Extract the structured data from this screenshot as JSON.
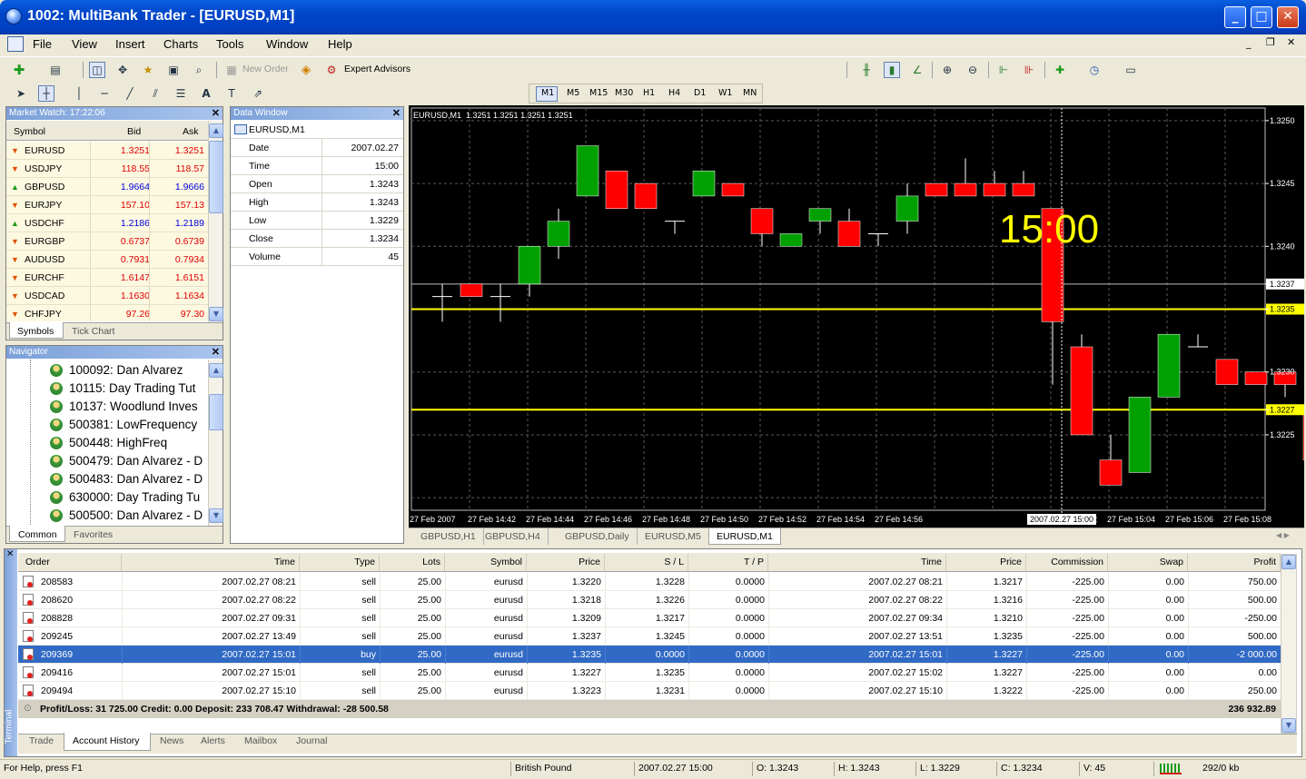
{
  "window": {
    "title": "1002: MultiBank Trader - [EURUSD,M1]"
  },
  "menu": [
    "File",
    "View",
    "Insert",
    "Charts",
    "Tools",
    "Window",
    "Help"
  ],
  "toolbar": {
    "new_order": "New Order",
    "expert_advisors": "Expert Advisors"
  },
  "timeframes": [
    "M1",
    "M5",
    "M15",
    "M30",
    "H1",
    "H4",
    "D1",
    "W1",
    "MN"
  ],
  "market_watch": {
    "title": "Market Watch: 17:22:06",
    "headers": {
      "symbol": "Symbol",
      "bid": "Bid",
      "ask": "Ask"
    },
    "rows": [
      {
        "symbol": "EURUSD",
        "bid": "1.3251",
        "ask": "1.3251",
        "dir": "down",
        "color": "#e00000"
      },
      {
        "symbol": "USDJPY",
        "bid": "118.55",
        "ask": "118.57",
        "dir": "down",
        "color": "#e00000"
      },
      {
        "symbol": "GBPUSD",
        "bid": "1.9664",
        "ask": "1.9666",
        "dir": "up",
        "color": "#0000e0"
      },
      {
        "symbol": "EURJPY",
        "bid": "157.10",
        "ask": "157.13",
        "dir": "down",
        "color": "#e00000"
      },
      {
        "symbol": "USDCHF",
        "bid": "1.2186",
        "ask": "1.2189",
        "dir": "up",
        "color": "#0000e0"
      },
      {
        "symbol": "EURGBP",
        "bid": "0.6737",
        "ask": "0.6739",
        "dir": "down",
        "color": "#e00000"
      },
      {
        "symbol": "AUDUSD",
        "bid": "0.7931",
        "ask": "0.7934",
        "dir": "down",
        "color": "#e00000"
      },
      {
        "symbol": "EURCHF",
        "bid": "1.6147",
        "ask": "1.6151",
        "dir": "down",
        "color": "#e00000"
      },
      {
        "symbol": "USDCAD",
        "bid": "1.1630",
        "ask": "1.1634",
        "dir": "down",
        "color": "#e00000"
      },
      {
        "symbol": "CHFJPY",
        "bid": "97.26",
        "ask": "97.30",
        "dir": "down",
        "color": "#e00000"
      }
    ],
    "tabs": [
      "Symbols",
      "Tick Chart"
    ]
  },
  "data_window": {
    "title": "Data Window",
    "symbol": "EURUSD,M1",
    "rows": [
      {
        "label": "Date",
        "value": "2007.02.27"
      },
      {
        "label": "Time",
        "value": "15:00"
      },
      {
        "label": "Open",
        "value": "1.3243"
      },
      {
        "label": "High",
        "value": "1.3243"
      },
      {
        "label": "Low",
        "value": "1.3229"
      },
      {
        "label": "Close",
        "value": "1.3234"
      },
      {
        "label": "Volume",
        "value": "45"
      }
    ]
  },
  "navigator": {
    "title": "Navigator",
    "items": [
      "100092: Dan Alvarez",
      "10115: Day Trading Tut",
      "10137: Woodlund Inves",
      "500381: LowFrequency",
      "500448: HighFreq",
      "500479: Dan Alvarez - D",
      "500483: Dan Alvarez - D",
      "630000: Day Trading Tu",
      "500500: Dan Alvarez - D"
    ],
    "tabs": [
      "Common",
      "Favorites"
    ]
  },
  "chart": {
    "header": "EURUSD,M1  1.3251 1.3251 1.3251 1.3251",
    "crosshair_label": "15:00",
    "crosshair_time": "2007.02.27 15:00",
    "price_labels": [
      "1.3250",
      "1.3245",
      "1.3240",
      "1.3237",
      "1.3235",
      "1.3230",
      "1.3227",
      "1.3225"
    ],
    "time_labels": [
      "27 Feb 2007",
      "27 Feb 14:42",
      "27 Feb 14:44",
      "27 Feb 14:46",
      "27 Feb 14:48",
      "27 Feb 14:50",
      "27 Feb 14:52",
      "27 Feb 14:54",
      "27 Feb 14:56",
      "27 Feb 15:02",
      "27 Feb 15:04",
      "27 Feb 15:06",
      "27 Feb 15:08"
    ],
    "tabs": [
      "GBPUSD,H1",
      "GBPUSD,H4",
      "GBPUSD,Daily",
      "EURUSD,M5",
      "EURUSD,M1"
    ],
    "bull_color": "#00a000",
    "bear_color": "#ff0000",
    "level_color": "#ffff00"
  },
  "chart_data": {
    "type": "candlestick",
    "ylim": [
      1.3219,
      1.3251
    ],
    "levels": [
      1.3235,
      1.3227
    ],
    "bid_line": 1.3237,
    "candles": [
      {
        "o": 1.3236,
        "h": 1.3237,
        "l": 1.3234,
        "c": 1.3236
      },
      {
        "o": 1.3237,
        "h": 1.3237,
        "l": 1.3236,
        "c": 1.3236
      },
      {
        "o": 1.3236,
        "h": 1.3237,
        "l": 1.3234,
        "c": 1.3236
      },
      {
        "o": 1.3237,
        "h": 1.324,
        "l": 1.3236,
        "c": 1.324
      },
      {
        "o": 1.324,
        "h": 1.3243,
        "l": 1.3239,
        "c": 1.3242
      },
      {
        "o": 1.3244,
        "h": 1.3248,
        "l": 1.3244,
        "c": 1.3248
      },
      {
        "o": 1.3246,
        "h": 1.3246,
        "l": 1.3243,
        "c": 1.3243
      },
      {
        "o": 1.3245,
        "h": 1.3245,
        "l": 1.3243,
        "c": 1.3243
      },
      {
        "o": 1.3242,
        "h": 1.3242,
        "l": 1.3241,
        "c": 1.3242
      },
      {
        "o": 1.3244,
        "h": 1.3246,
        "l": 1.3244,
        "c": 1.3246
      },
      {
        "o": 1.3245,
        "h": 1.3245,
        "l": 1.3244,
        "c": 1.3244
      },
      {
        "o": 1.3243,
        "h": 1.3243,
        "l": 1.324,
        "c": 1.3241
      },
      {
        "o": 1.324,
        "h": 1.3241,
        "l": 1.324,
        "c": 1.3241
      },
      {
        "o": 1.3242,
        "h": 1.3243,
        "l": 1.3241,
        "c": 1.3243
      },
      {
        "o": 1.3242,
        "h": 1.3243,
        "l": 1.324,
        "c": 1.324
      },
      {
        "o": 1.3241,
        "h": 1.3241,
        "l": 1.324,
        "c": 1.3241
      },
      {
        "o": 1.3242,
        "h": 1.3245,
        "l": 1.3241,
        "c": 1.3244
      },
      {
        "o": 1.3245,
        "h": 1.3245,
        "l": 1.3244,
        "c": 1.3244
      },
      {
        "o": 1.3245,
        "h": 1.3247,
        "l": 1.3244,
        "c": 1.3244
      },
      {
        "o": 1.3245,
        "h": 1.3246,
        "l": 1.3244,
        "c": 1.3244
      },
      {
        "o": 1.3245,
        "h": 1.3246,
        "l": 1.3244,
        "c": 1.3244
      },
      {
        "o": 1.3243,
        "h": 1.3243,
        "l": 1.3229,
        "c": 1.3234
      },
      {
        "o": 1.3232,
        "h": 1.3233,
        "l": 1.3225,
        "c": 1.3225
      },
      {
        "o": 1.3223,
        "h": 1.3225,
        "l": 1.3221,
        "c": 1.3221
      },
      {
        "o": 1.3222,
        "h": 1.3228,
        "l": 1.3222,
        "c": 1.3228
      },
      {
        "o": 1.3228,
        "h": 1.3233,
        "l": 1.3228,
        "c": 1.3233
      },
      {
        "o": 1.3232,
        "h": 1.3233,
        "l": 1.3232,
        "c": 1.3232
      },
      {
        "o": 1.3231,
        "h": 1.3231,
        "l": 1.3229,
        "c": 1.3229
      },
      {
        "o": 1.323,
        "h": 1.323,
        "l": 1.3229,
        "c": 1.3229
      },
      {
        "o": 1.323,
        "h": 1.323,
        "l": 1.3228,
        "c": 1.3229
      },
      {
        "o": 1.3227,
        "h": 1.3227,
        "l": 1.3223,
        "c": 1.3223
      }
    ]
  },
  "terminal": {
    "headers": [
      "Order",
      "Time",
      "Type",
      "Lots",
      "Symbol",
      "Price",
      "S / L",
      "T / P",
      "Time",
      "Price",
      "Commission",
      "Swap",
      "Profit"
    ],
    "rows": [
      [
        "208583",
        "2007.02.27 08:21",
        "sell",
        "25.00",
        "eurusd",
        "1.3220",
        "1.3228",
        "0.0000",
        "2007.02.27 08:21",
        "1.3217",
        "-225.00",
        "0.00",
        "750.00"
      ],
      [
        "208620",
        "2007.02.27 08:22",
        "sell",
        "25.00",
        "eurusd",
        "1.3218",
        "1.3226",
        "0.0000",
        "2007.02.27 08:22",
        "1.3216",
        "-225.00",
        "0.00",
        "500.00"
      ],
      [
        "208828",
        "2007.02.27 09:31",
        "sell",
        "25.00",
        "eurusd",
        "1.3209",
        "1.3217",
        "0.0000",
        "2007.02.27 09:34",
        "1.3210",
        "-225.00",
        "0.00",
        "-250.00"
      ],
      [
        "209245",
        "2007.02.27 13:49",
        "sell",
        "25.00",
        "eurusd",
        "1.3237",
        "1.3245",
        "0.0000",
        "2007.02.27 13:51",
        "1.3235",
        "-225.00",
        "0.00",
        "500.00"
      ],
      [
        "209369",
        "2007.02.27 15:01",
        "buy",
        "25.00",
        "eurusd",
        "1.3235",
        "0.0000",
        "0.0000",
        "2007.02.27 15:01",
        "1.3227",
        "-225.00",
        "0.00",
        "-2 000.00"
      ],
      [
        "209416",
        "2007.02.27 15:01",
        "sell",
        "25.00",
        "eurusd",
        "1.3227",
        "1.3235",
        "0.0000",
        "2007.02.27 15:02",
        "1.3227",
        "-225.00",
        "0.00",
        "0.00"
      ],
      [
        "209494",
        "2007.02.27 15:10",
        "sell",
        "25.00",
        "eurusd",
        "1.3223",
        "1.3231",
        "0.0000",
        "2007.02.27 15:10",
        "1.3222",
        "-225.00",
        "0.00",
        "250.00"
      ]
    ],
    "selected_row": 4,
    "summary": "Profit/Loss: 31 725.00  Credit: 0.00  Deposit: 233 708.47  Withdrawal: -28 500.58",
    "summary_total": "236 932.89",
    "tabs": [
      "Trade",
      "Account History",
      "News",
      "Alerts",
      "Mailbox",
      "Journal"
    ],
    "side_label": "Terminal"
  },
  "status": {
    "help": "For Help, press F1",
    "profile": "British Pound",
    "datetime": "2007.02.27 15:00",
    "open": "O: 1.3243",
    "high": "H: 1.3243",
    "low": "L: 1.3229",
    "close": "C: 1.3234",
    "volume": "V: 45",
    "traffic": "292/0 kb"
  }
}
